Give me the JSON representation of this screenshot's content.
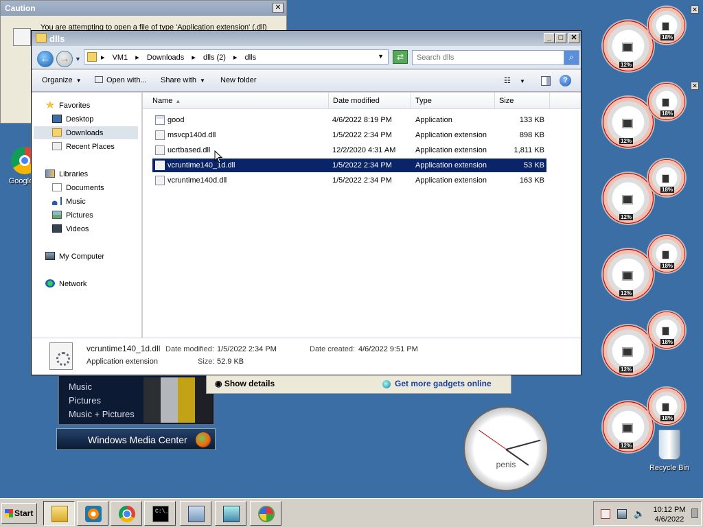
{
  "caution": {
    "title": "Caution",
    "message": "You are attempting to open a file of type 'Application extension' (.dll)",
    "close": "✕"
  },
  "desktop": {
    "chrome_label": "Google C",
    "recycle_bin": "Recycle Bin",
    "clock_label": "penis"
  },
  "gadgets": {
    "show_details": "Show details",
    "get_more": "Get more gadgets online",
    "cpu_meters": [
      {
        "cpu": "12%",
        "mem": "18%"
      },
      {
        "cpu": "12%",
        "mem": "18%"
      },
      {
        "cpu": "12%",
        "mem": "18%"
      },
      {
        "cpu": "12%",
        "mem": "18%"
      },
      {
        "cpu": "12%",
        "mem": "18%"
      },
      {
        "cpu": "12%",
        "mem": "18%"
      }
    ]
  },
  "media_center": {
    "items": [
      "Music",
      "Pictures",
      "Music + Pictures"
    ],
    "button_label": "Windows Media Center"
  },
  "explorer": {
    "title": "dlls",
    "breadcrumbs": [
      "VM1",
      "▸",
      "Downloads",
      "▸",
      "dlls (2)",
      "▸",
      "dlls"
    ],
    "search_placeholder": "Search dlls",
    "toolbar": {
      "organize": "Organize",
      "open_with": "Open with...",
      "share_with": "Share with",
      "new_folder": "New folder"
    },
    "nav": {
      "favorites": "Favorites",
      "desktop": "Desktop",
      "downloads": "Downloads",
      "recent_places": "Recent Places",
      "libraries": "Libraries",
      "documents": "Documents",
      "music": "Music",
      "pictures": "Pictures",
      "videos": "Videos",
      "my_computer": "My Computer",
      "network": "Network"
    },
    "columns": {
      "name": "Name",
      "date": "Date modified",
      "type": "Type",
      "size": "Size"
    },
    "files": [
      {
        "name": "good",
        "date": "4/6/2022 8:19 PM",
        "type": "Application",
        "size": "133 KB"
      },
      {
        "name": "msvcp140d.dll",
        "date": "1/5/2022 2:34 PM",
        "type": "Application extension",
        "size": "898 KB"
      },
      {
        "name": "ucrtbased.dll",
        "date": "12/2/2020 4:31 AM",
        "type": "Application extension",
        "size": "1,811 KB"
      },
      {
        "name": "vcruntime140_1d.dll",
        "date": "1/5/2022 2:34 PM",
        "type": "Application extension",
        "size": "53 KB"
      },
      {
        "name": "vcruntime140d.dll",
        "date": "1/5/2022 2:34 PM",
        "type": "Application extension",
        "size": "163 KB"
      }
    ],
    "details": {
      "filename": "vcruntime140_1d.dll",
      "filetype": "Application extension",
      "modified_label": "Date modified:",
      "modified_value": "1/5/2022 2:34 PM",
      "size_label": "Size:",
      "size_value": "52.9 KB",
      "created_label": "Date created:",
      "created_value": "4/6/2022 9:51 PM"
    }
  },
  "taskbar": {
    "start": "Start",
    "time": "10:12 PM",
    "date": "4/6/2022"
  }
}
